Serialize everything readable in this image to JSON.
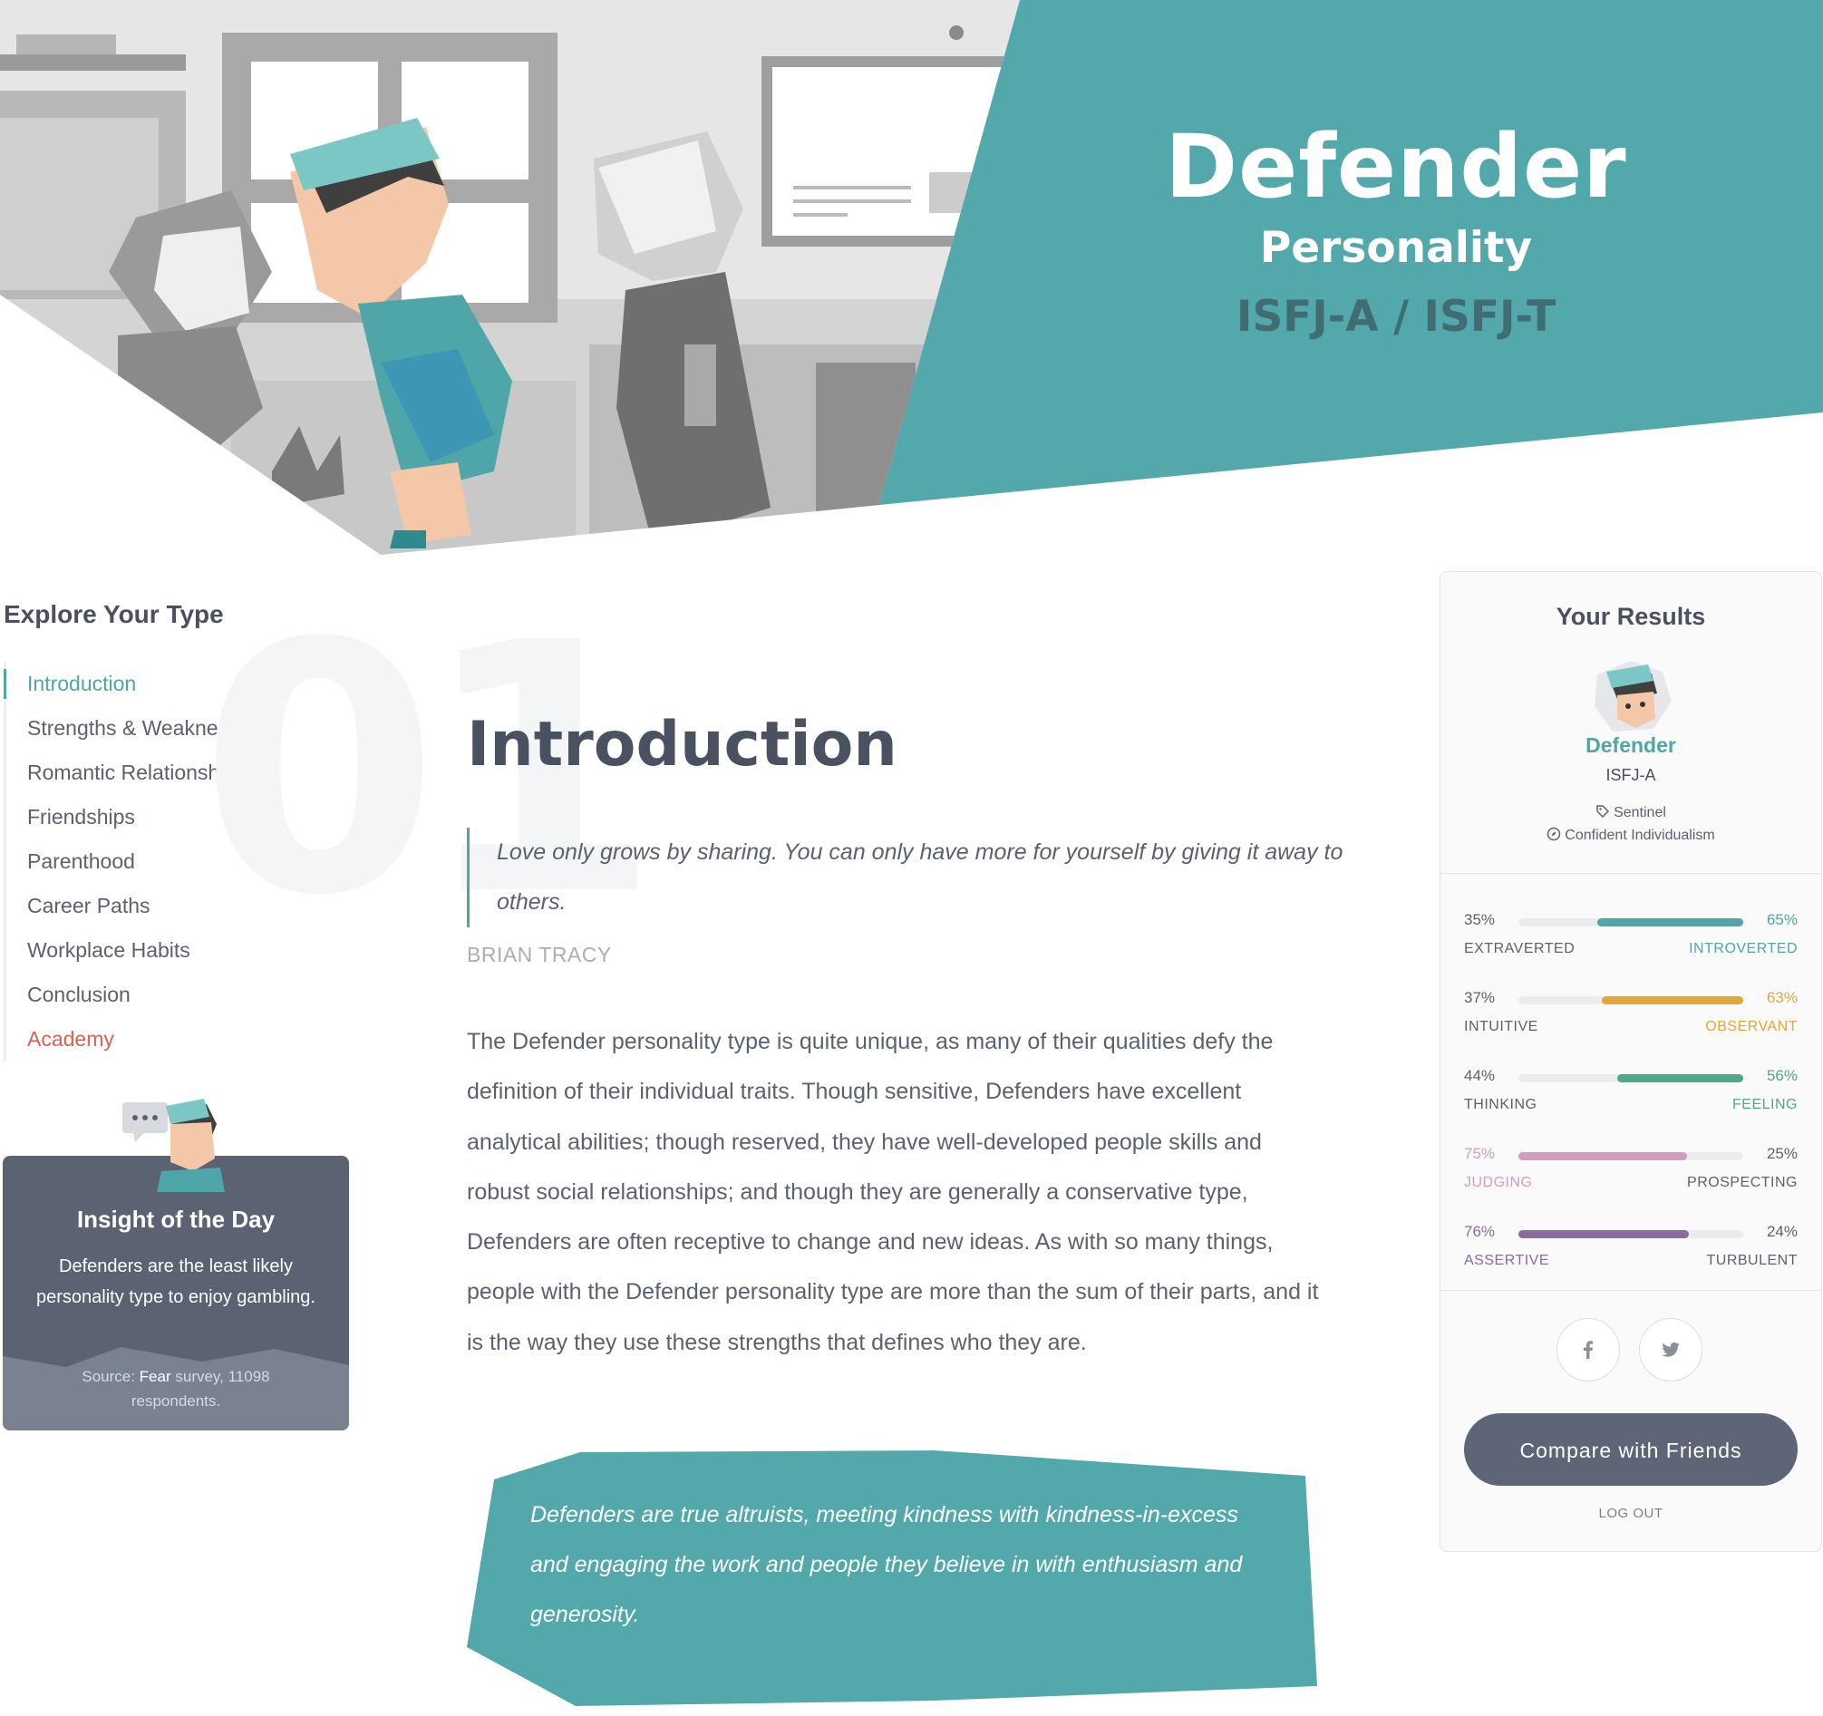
{
  "hero": {
    "type_name": "Defender",
    "subtitle": "Personality",
    "codes": "ISFJ-A / ISFJ-T",
    "accent_color": "#52a8ab"
  },
  "nav": {
    "title": "Explore Your Type",
    "items": [
      {
        "label": "Introduction",
        "state": "active"
      },
      {
        "label": "Strengths & Weaknesses"
      },
      {
        "label": "Romantic Relationships"
      },
      {
        "label": "Friendships"
      },
      {
        "label": "Parenthood"
      },
      {
        "label": "Career Paths"
      },
      {
        "label": "Workplace Habits"
      },
      {
        "label": "Conclusion"
      },
      {
        "label": "Academy",
        "state": "highlight"
      }
    ]
  },
  "insight": {
    "title": "Insight of the Day",
    "text": "Defenders are the least likely personality type to enjoy gambling.",
    "source_prefix": "Source: ",
    "source_name": "Fear",
    "source_suffix": " survey, 11098 respondents."
  },
  "main": {
    "section_number": "01",
    "section_title": "Introduction",
    "quote": "Love only grows by sharing. You can only have more for yourself by giving it away to others.",
    "quote_author": "BRIAN TRACY",
    "paragraph": "The Defender personality type is quite unique, as many of their qualities defy the definition of their individual traits. Though sensitive, Defenders have excellent analytical abilities; though reserved, they have well-developed people skills and robust social relationships; and though they are generally a conservative type, Defenders are often receptive to change and new ideas. As with so many things, people with the Defender personality type are more than the sum of their parts, and it is the way they use these strengths that defines who they are.",
    "callout": "Defenders are true altruists, meeting kindness with kindness-in-excess and engaging the work and people they believe in with enthusiasm and generosity."
  },
  "results": {
    "title": "Your Results",
    "type_name": "Defender",
    "code": "ISFJ-A",
    "role": "Sentinel",
    "strategy": "Confident Individualism",
    "traits": [
      {
        "left_pct": "35%",
        "right_pct": "65%",
        "left_label": "EXTRAVERTED",
        "right_label": "INTROVERTED",
        "dominant": "right",
        "value": 65,
        "color": "#4ea6a9"
      },
      {
        "left_pct": "37%",
        "right_pct": "63%",
        "left_label": "INTUITIVE",
        "right_label": "OBSERVANT",
        "dominant": "right",
        "value": 63,
        "color": "#e0a73a"
      },
      {
        "left_pct": "44%",
        "right_pct": "56%",
        "left_label": "THINKING",
        "right_label": "FEELING",
        "dominant": "right",
        "value": 56,
        "color": "#4caa86"
      },
      {
        "left_pct": "75%",
        "right_pct": "25%",
        "left_label": "JUDGING",
        "right_label": "PROSPECTING",
        "dominant": "left",
        "value": 75,
        "color": "#d39bbd"
      },
      {
        "left_pct": "76%",
        "right_pct": "24%",
        "left_label": "ASSERTIVE",
        "right_label": "TURBULENT",
        "dominant": "left",
        "value": 76,
        "color": "#8c6a9f"
      }
    ],
    "share_icons": [
      "facebook-icon",
      "twitter-icon"
    ],
    "compare_label": "Compare with Friends",
    "logout_label": "LOG OUT"
  }
}
